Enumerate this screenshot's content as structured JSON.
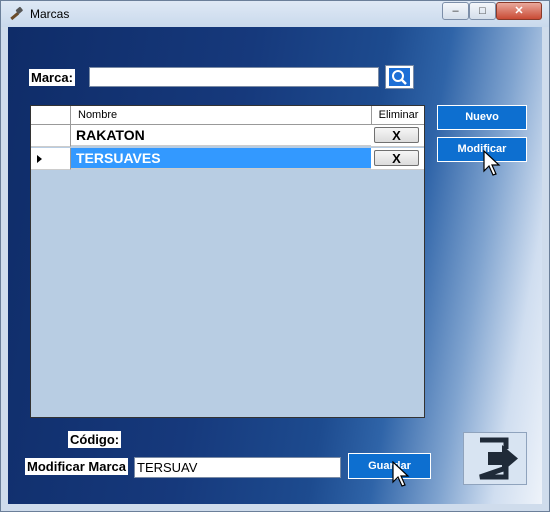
{
  "window": {
    "title": "Marcas",
    "minimize": "–",
    "maximize": "□",
    "close": "✕"
  },
  "search": {
    "label": "Marca:",
    "value": "",
    "icon": "search-icon"
  },
  "grid": {
    "columns": [
      "",
      "Nombre",
      "Eliminar"
    ],
    "rows": [
      {
        "name": "RAKATON",
        "delete_label": "X",
        "selected": false
      },
      {
        "name": "TERSUAVES",
        "delete_label": "X",
        "selected": true
      }
    ]
  },
  "buttons": {
    "nuevo": "Nuevo",
    "modificar": "Modificar",
    "guardar": "Guardar"
  },
  "form": {
    "codigo_label": "Código:",
    "modificar_label": "Modificar Marca",
    "modificar_value": "TERSUAV"
  },
  "colors": {
    "selection": "#3399ff",
    "button_blue": "#0d6fd0",
    "grid_bg": "#b8cde3"
  },
  "icons": {
    "exit": "exit-arrow-icon",
    "app": "hammer-icon",
    "cursor": "mouse-pointer-icon"
  }
}
